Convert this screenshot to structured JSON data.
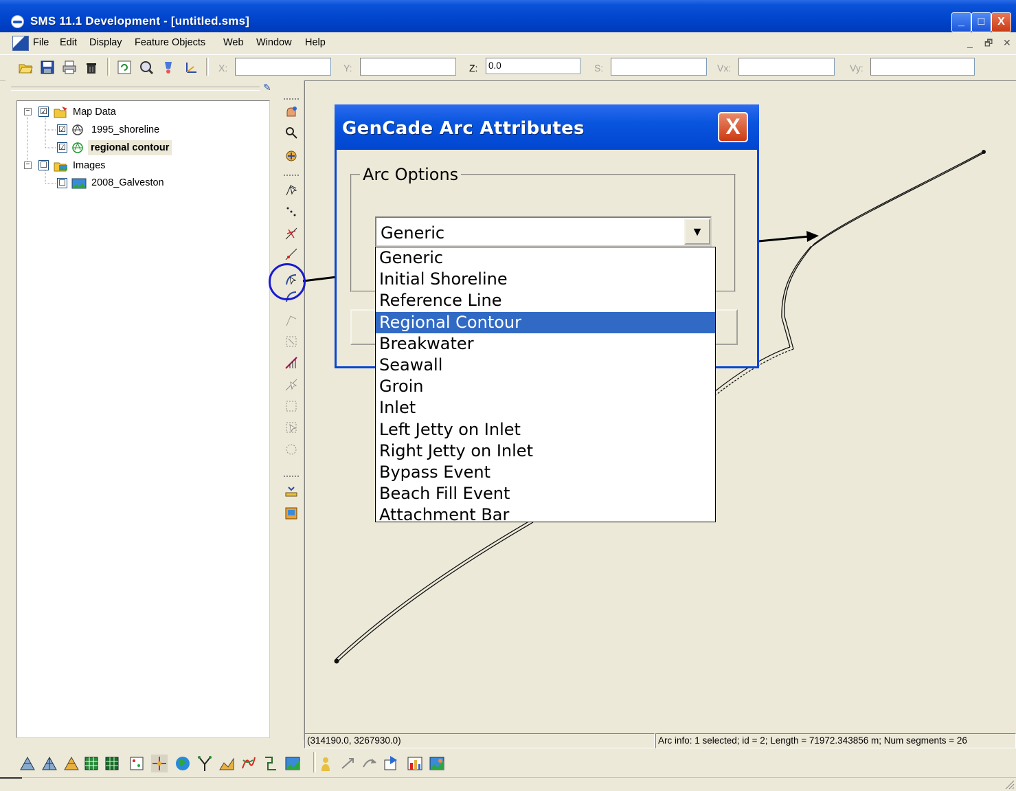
{
  "window": {
    "title": "SMS 11.1 Development - [untitled.sms]",
    "controls": {
      "minimize": "_",
      "maximize": "□",
      "close": "X"
    }
  },
  "menu": [
    "File",
    "Edit",
    "Display",
    "Feature Objects",
    "Web",
    "Window",
    "Help"
  ],
  "mdi_controls": {
    "minimize": "_",
    "restore": "🗗",
    "close": "✕"
  },
  "coords": {
    "x_label": "X:",
    "x_value": "",
    "y_label": "Y:",
    "y_value": "",
    "z_label": "Z:",
    "z_value": "0.0",
    "s_label": "S:",
    "s_value": "",
    "vx_label": "Vx:",
    "vx_value": "",
    "vy_label": "Vy:",
    "vy_value": ""
  },
  "tree": {
    "items": [
      {
        "label": "Map Data",
        "checked": "☑",
        "expander": "−",
        "icon": "map-data-icon"
      },
      {
        "label": "1995_shoreline",
        "checked": "☑",
        "icon": "coverage-icon"
      },
      {
        "label": "regional contour",
        "checked": "☑",
        "icon": "coverage-active-icon"
      },
      {
        "label": "Images",
        "checked": "☐",
        "expander": "−",
        "icon": "images-folder-icon"
      },
      {
        "label": "2008_Galveston",
        "checked": "☐",
        "icon": "image-icon"
      }
    ]
  },
  "dialog": {
    "title": "GenCade Arc Attributes",
    "close_label": "X",
    "group_label": "Arc Options",
    "selected_value": "Generic",
    "dropdown_arrow": "▼",
    "options": [
      "Generic",
      "Initial Shoreline",
      "Reference Line",
      "Regional Contour",
      "Breakwater",
      "Seawall",
      "Groin",
      "Inlet",
      "Left Jetty on Inlet",
      "Right Jetty on Inlet",
      "Bypass Event",
      "Beach Fill Event",
      "Attachment Bar"
    ],
    "highlighted_option": "Regional Contour"
  },
  "status": {
    "coordinates": "(314190.0, 3267930.0)",
    "arc_info": "Arc info: 1 selected; id = 2; Length = 71972.343856 m; Num segments = 26"
  },
  "colors": {
    "titlebar": "#0a53d8",
    "selection": "#316ac5",
    "window_bg": "#ece9d8",
    "highlight_ring": "#1a1ad0"
  }
}
